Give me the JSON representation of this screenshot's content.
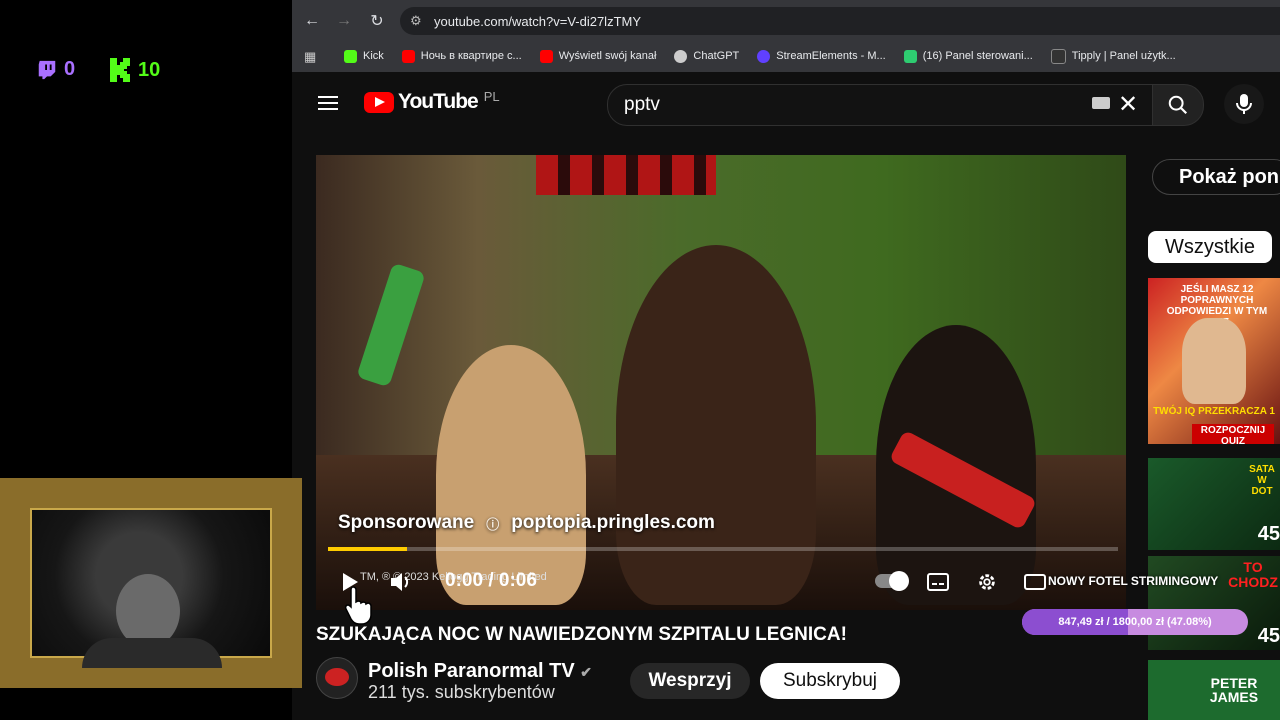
{
  "overlay": {
    "twitch_icon": "twitch-chat-icon",
    "twitch_count": "0",
    "kick_icon": "kick-icon",
    "kick_count": "10",
    "goal_label": "NOWY FOTEL STRIMINGOWY",
    "goal_current": "847,49 zł",
    "goal_separator": "/",
    "goal_target": "1800,00 zł",
    "goal_percent": "(47.08%)",
    "goal_fraction": 0.4708,
    "colors": {
      "twitch": "#a970ff",
      "kick": "#53fc18",
      "goal_fill": "#8c4ed0"
    }
  },
  "browser": {
    "url": "youtube.com/watch?v=V-di27lzTMY",
    "bookmarks": [
      {
        "label": "Kick",
        "color": "#53fc18"
      },
      {
        "label": "Ночь в квартире с...",
        "color": "#ff0000"
      },
      {
        "label": "Wyświetl swój kanał",
        "color": "#ff0000"
      },
      {
        "label": "ChatGPT",
        "color": "#cccccc"
      },
      {
        "label": "StreamElements - M...",
        "color": "#6040ff"
      },
      {
        "label": "(16) Panel sterowani...",
        "color": "#2ecc71"
      },
      {
        "label": "Tipply | Panel użytk...",
        "color": "#333333"
      }
    ]
  },
  "youtube": {
    "logo_text": "YouTube",
    "country_code": "PL",
    "search_value": "pptv"
  },
  "player": {
    "sponsored_label": "Sponsorowane",
    "ad_domain": "poptopia.pringles.com",
    "ad_progress": 0.1,
    "ad_copyright": "TM, ® © 2023 Kellogg Trading Limited",
    "time_current": "0:00",
    "time_separator": "/",
    "time_total": "0:06"
  },
  "video": {
    "title": "SZUKAJĄCA NOC W NAWIEDZONYM SZPITALU LEGNICA!",
    "channel_name": "Polish Paranormal TV",
    "subscribers": "211 tys. subskrybentów",
    "support_label": "Wesprzyj",
    "subscribe_label": "Subskrybuj"
  },
  "sidebar": {
    "show_more_label": "Pokaż pon",
    "chip_all": "Wszystkie",
    "thumbs": [
      {
        "text": "JEŚLI MASZ 12 POPRAWNYCH ODPOWIEDZI W TYM QUIZ",
        "bottom": "TWÓJ IQ PRZEKRACZA 1",
        "button": "ROZPOCZNIJ QUIZ"
      },
      {
        "text": "SATA W DOT",
        "badge": "45"
      },
      {
        "text": "TO CHODZ",
        "badge": "45"
      },
      {
        "text": "PETER JAMES"
      }
    ]
  }
}
